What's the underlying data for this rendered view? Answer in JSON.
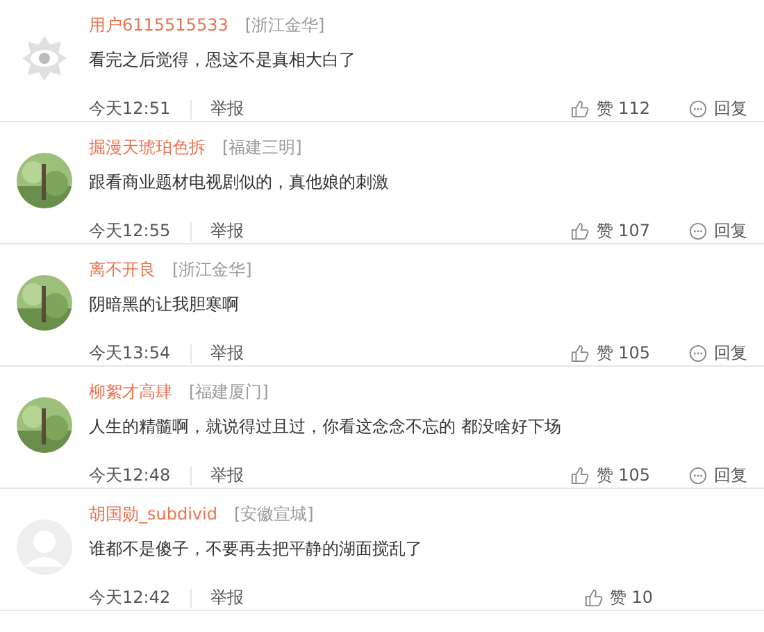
{
  "comments": [
    {
      "avatar": {
        "kind": "default"
      },
      "user": "用户6115515533",
      "location": "[浙江金华]",
      "text": "看完之后觉得，恩这不是真相大白了",
      "time": "今天12:51",
      "report": "举报",
      "like_label": "赞",
      "likes": "112",
      "reply": "回复"
    },
    {
      "user": "掘漫天琥珀色拆",
      "location": "[福建三明]",
      "text": "跟看商业题材电视剧似的，真他娘的刺激",
      "time": "今天12:55",
      "report": "举报",
      "like_label": "赞",
      "likes": "107",
      "reply": "回复"
    },
    {
      "user": "离不开良",
      "location": "[浙江金华]",
      "text": "阴暗黑的让我胆寒啊",
      "time": "今天13:54",
      "report": "举报",
      "like_label": "赞",
      "likes": "105",
      "reply": "回复"
    },
    {
      "user": "柳絮才高肆",
      "location": "[福建厦门]",
      "text": "人生的精髓啊，就说得过且过，你看这念念不忘的 都没啥好下场",
      "time": "今天12:48",
      "report": "举报",
      "like_label": "赞",
      "likes": "105",
      "reply": "回复"
    },
    {
      "avatar": {
        "kind": "silhouette"
      },
      "user": "胡国勋_subdivid",
      "location": "[安徽宣城]",
      "text": "谁都不是傻子，不要再去把平静的湖面搅乱了",
      "time": "今天12:42",
      "report": "举报",
      "like_label": "赞",
      "likes": "10"
    }
  ]
}
